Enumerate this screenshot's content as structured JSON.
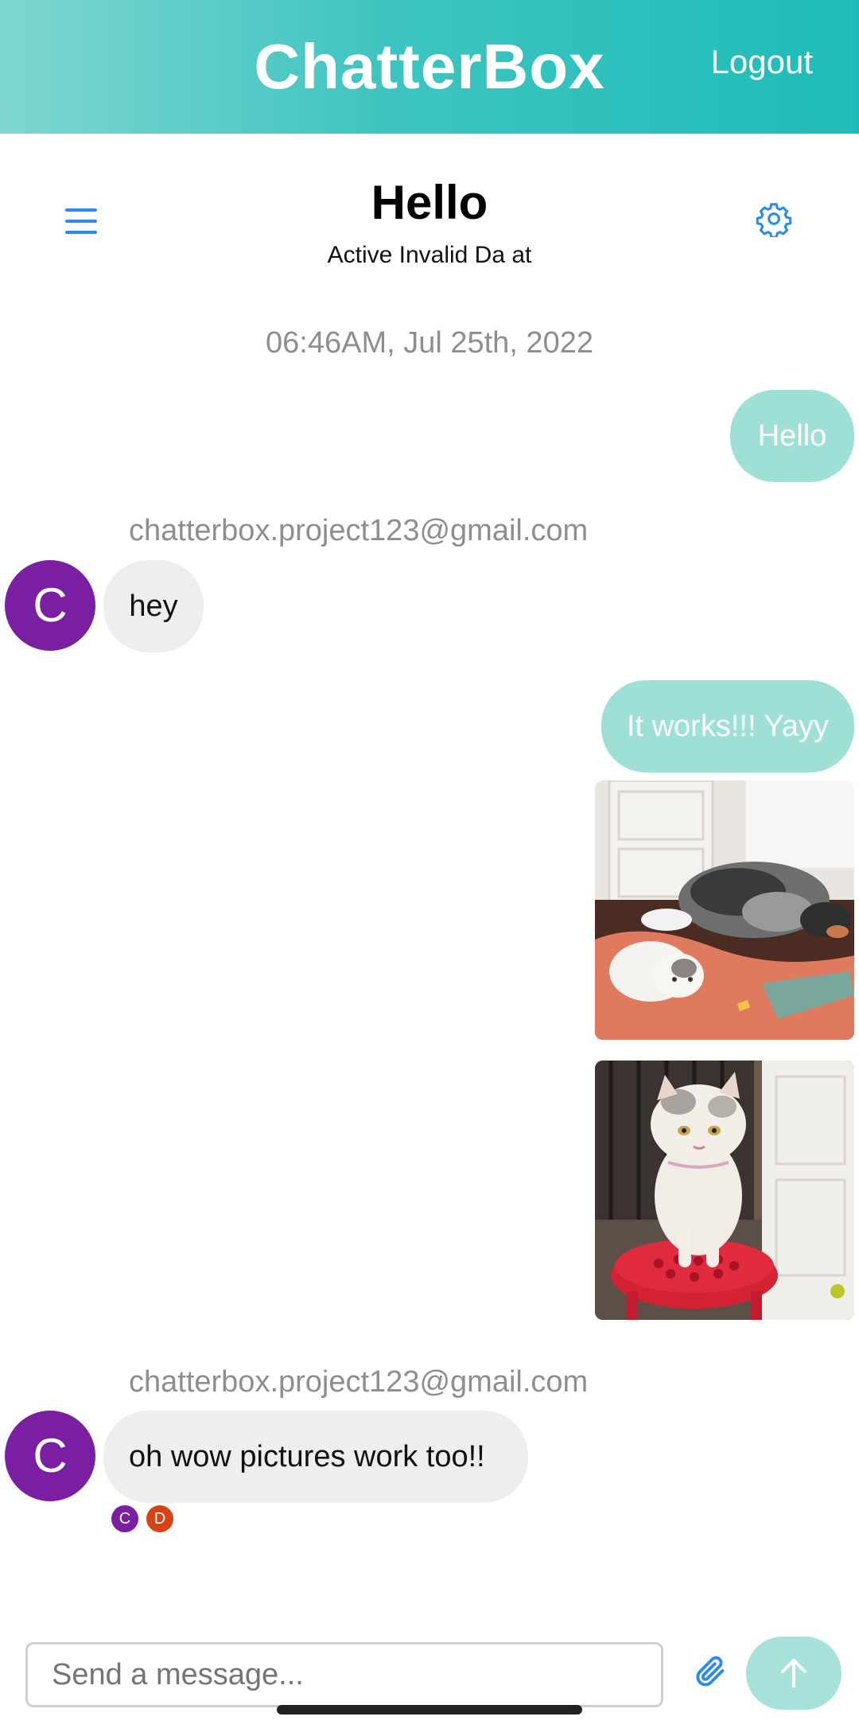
{
  "header": {
    "brand": "ChatterBox",
    "logout_label": "Logout"
  },
  "chat": {
    "title": "Hello",
    "subtitle": "Active Invalid Da at",
    "timestamp": "06:46AM, Jul 25th, 2022"
  },
  "messages": [
    {
      "direction": "outgoing",
      "text": "Hello"
    },
    {
      "direction": "incoming",
      "sender": "chatterbox.project123@gmail.com",
      "avatar_letter": "C",
      "text": "hey"
    },
    {
      "direction": "outgoing",
      "text": "It works!!! Yayy"
    },
    {
      "direction": "outgoing",
      "type": "image",
      "subject": "cat and dog on floor"
    },
    {
      "direction": "outgoing",
      "type": "image",
      "subject": "cat on red stool"
    },
    {
      "direction": "incoming",
      "sender": "chatterbox.project123@gmail.com",
      "avatar_letter": "C",
      "text": "oh wow pictures work too!!"
    }
  ],
  "read_receipts": [
    {
      "letter": "C",
      "color": "#7b1fa2"
    },
    {
      "letter": "D",
      "color": "#d84315"
    }
  ],
  "composer": {
    "placeholder": "Send a message..."
  },
  "colors": {
    "accent": "#1ebcb8",
    "outgoing_bubble": "#9fe0d6",
    "incoming_bubble": "#eeeeee",
    "icon_blue": "#2c8be8",
    "avatar_purple": "#7b1fa2"
  },
  "icons": {
    "menu": "menu-icon",
    "settings": "gear-icon",
    "attach": "paperclip-icon",
    "send": "arrow-up-icon"
  }
}
